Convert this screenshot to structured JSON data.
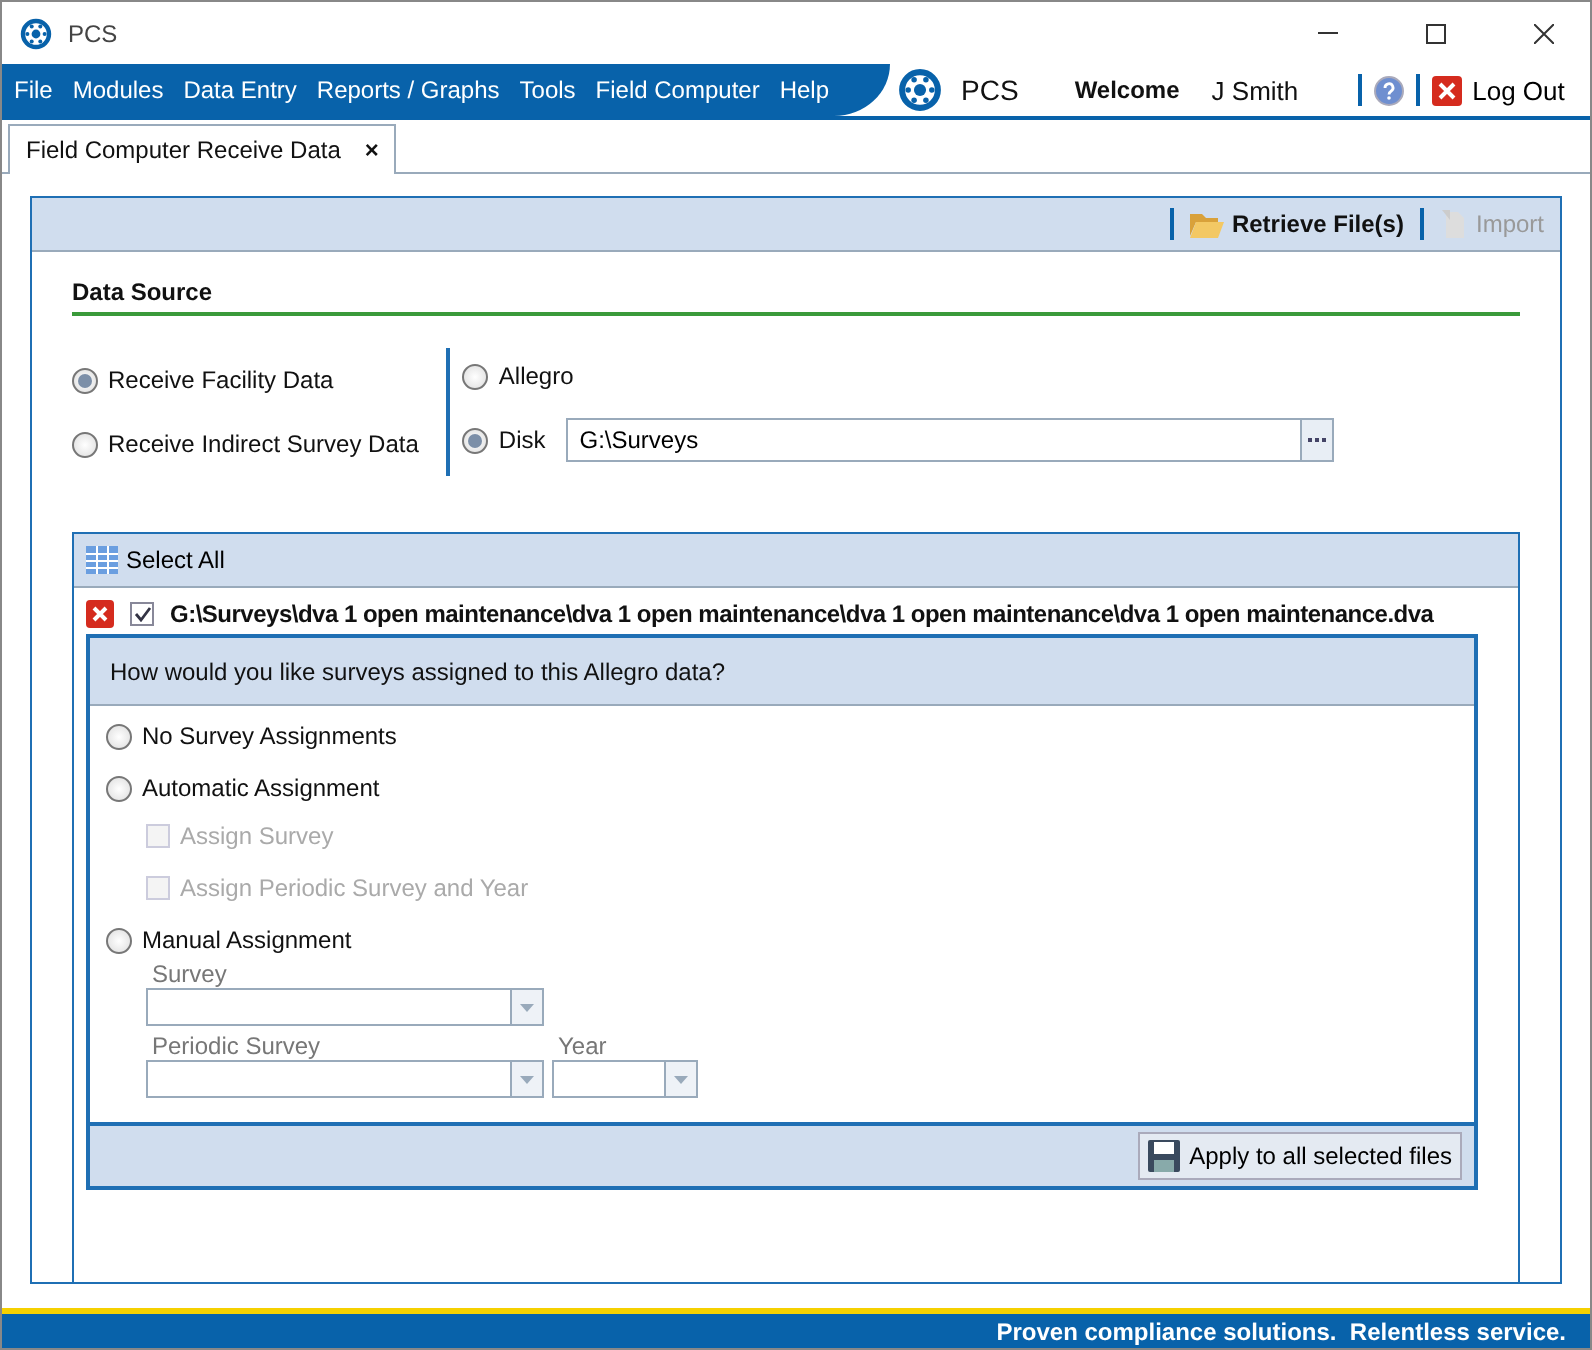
{
  "window": {
    "title": "PCS"
  },
  "menu": [
    "File",
    "Modules",
    "Data Entry",
    "Reports / Graphs",
    "Tools",
    "Field Computer",
    "Help"
  ],
  "header": {
    "brand": "PCS",
    "welcome": "Welcome",
    "user": "J Smith",
    "logout": "Log Out"
  },
  "tabs": [
    {
      "label": "Field Computer Receive Data",
      "selected": true,
      "close": "×"
    }
  ],
  "toolbar": [
    {
      "label": "Retrieve File(s)",
      "kind": "folder",
      "disabled": false
    },
    {
      "label": "Import",
      "kind": "import",
      "disabled": true
    }
  ],
  "data_source": {
    "title": "Data Source",
    "options_left": [
      {
        "label": "Receive Facility Data",
        "selected": true
      },
      {
        "label": "Receive Indirect Survey Data",
        "selected": false
      }
    ],
    "options_right": [
      {
        "label": "Allegro",
        "selected": false
      },
      {
        "label": "Disk",
        "selected": true
      }
    ],
    "path": "G:\\Surveys"
  },
  "files": {
    "select_all": "Select All",
    "items": [
      {
        "path": "G:\\Surveys\\dva 1 open maintenance\\dva 1 open maintenance\\dva 1 open maintenance\\dva 1 open maintenance.dva",
        "checked": true
      }
    ]
  },
  "assignment": {
    "question": "How would you like surveys assigned to this Allegro data?",
    "options": [
      {
        "label": "No Survey Assignments",
        "selected": false
      },
      {
        "label": "Automatic Assignment",
        "selected": false,
        "children": [
          {
            "label": "Assign Survey",
            "checked": false,
            "disabled": true
          },
          {
            "label": "Assign Periodic Survey and Year",
            "checked": false,
            "disabled": true
          }
        ]
      },
      {
        "label": "Manual Assignment",
        "selected": false,
        "field_rows": [
          [
            {
              "label": "Survey",
              "kind": "long"
            }
          ],
          [
            {
              "label": "Periodic Survey",
              "kind": "long"
            },
            {
              "label": "Year",
              "kind": "short"
            }
          ]
        ]
      }
    ],
    "apply": "Apply to all selected files"
  },
  "footer": "Proven compliance solutions.  Relentless service."
}
